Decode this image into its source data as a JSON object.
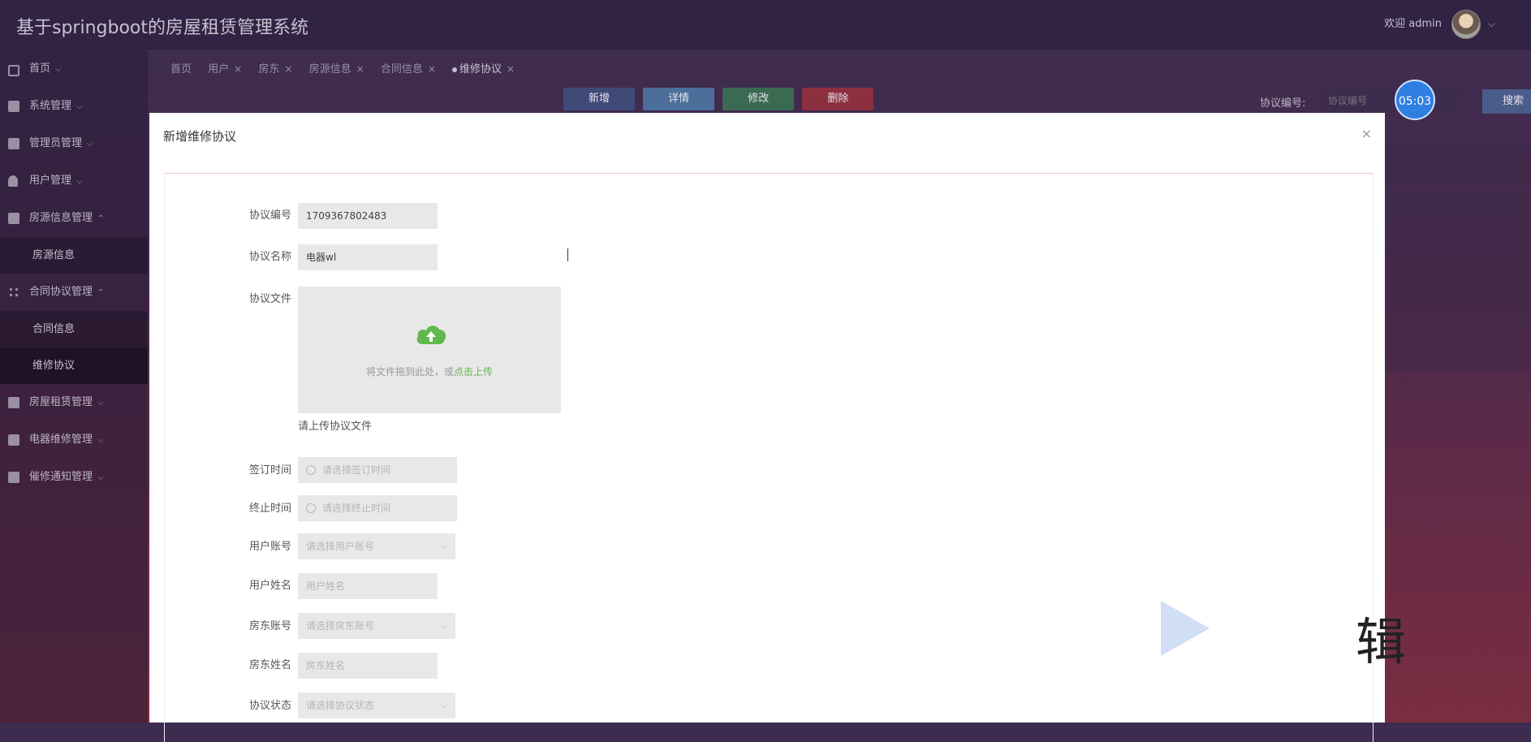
{
  "app": {
    "title": "基于springboot的房屋租赁管理系统",
    "welcome": "欢迎 admin"
  },
  "sidebar": {
    "items": [
      {
        "label": "首页"
      },
      {
        "label": "系统管理"
      },
      {
        "label": "管理员管理"
      },
      {
        "label": "用户管理"
      },
      {
        "label": "房源信息管理"
      },
      {
        "label": "房源信息"
      },
      {
        "label": "合同协议管理"
      },
      {
        "label": "合同信息"
      },
      {
        "label": "维修协议"
      },
      {
        "label": "房屋租赁管理"
      },
      {
        "label": "电器维修管理"
      },
      {
        "label": "催修通知管理"
      }
    ]
  },
  "tabs": [
    {
      "label": "首页"
    },
    {
      "label": "用户"
    },
    {
      "label": "房东"
    },
    {
      "label": "房源信息"
    },
    {
      "label": "合同信息"
    },
    {
      "label": "维修协议"
    }
  ],
  "actions": {
    "add": "新增",
    "detail": "详情",
    "edit": "修改",
    "delete": "删除"
  },
  "search": {
    "label": "协议编号:",
    "placeholder": "协议编号",
    "button": "搜索",
    "timer": "05:03"
  },
  "modal": {
    "title": "新增维修协议",
    "close": "×",
    "fields": {
      "agreement_no_label": "协议编号",
      "agreement_no_value": "1709367802483",
      "agreement_name_label": "协议名称",
      "agreement_name_value": "电器wl",
      "file_label": "协议文件",
      "upload_text": "将文件拖到此处，或",
      "upload_link": "点击上传",
      "upload_tip": "请上传协议文件",
      "sign_time_label": "签订时间",
      "sign_time_placeholder": "请选择签订时间",
      "end_time_label": "终止时间",
      "end_time_placeholder": "请选择终止时间",
      "user_account_label": "用户账号",
      "user_account_placeholder": "请选择用户账号",
      "user_name_label": "用户姓名",
      "user_name_placeholder": "用户姓名",
      "landlord_account_label": "房东账号",
      "landlord_account_placeholder": "请选择房东账号",
      "landlord_name_label": "房东姓名",
      "landlord_name_placeholder": "房东姓名",
      "status_label": "协议状态",
      "status_placeholder": "请选择协议状态"
    }
  },
  "watermark": {
    "text": "辑"
  },
  "colors": {
    "upload_accent": "#5fb94b",
    "timer_bg": "#2f7fe3"
  }
}
